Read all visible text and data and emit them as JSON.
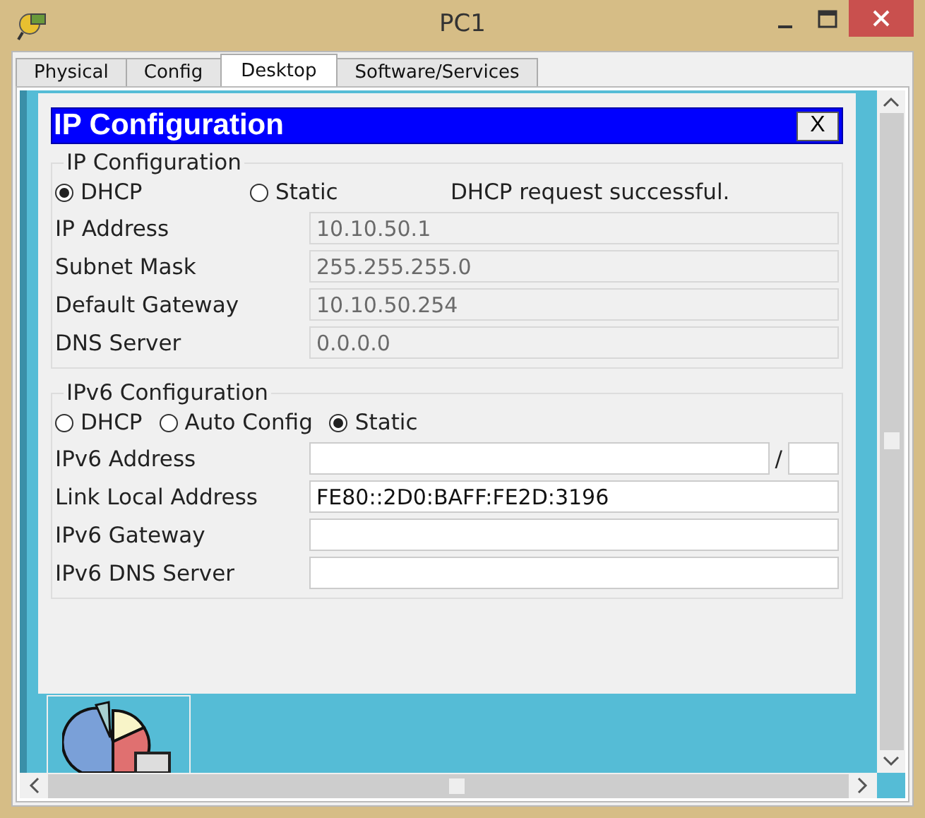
{
  "window": {
    "title": "PC1"
  },
  "tabs": [
    {
      "label": "Physical",
      "selected": false
    },
    {
      "label": "Config",
      "selected": false
    },
    {
      "label": "Desktop",
      "selected": true
    },
    {
      "label": "Software/Services",
      "selected": false
    }
  ],
  "dialog": {
    "title": "IP Configuration",
    "close": "X",
    "ipv4": {
      "legend": "IP Configuration",
      "modes": [
        {
          "label": "DHCP",
          "selected": true
        },
        {
          "label": "Static",
          "selected": false
        }
      ],
      "status": "DHCP request successful.",
      "fields": [
        {
          "label": "IP Address",
          "value": "10.10.50.1",
          "disabled": true
        },
        {
          "label": "Subnet Mask",
          "value": "255.255.255.0",
          "disabled": true
        },
        {
          "label": "Default Gateway",
          "value": "10.10.50.254",
          "disabled": true
        },
        {
          "label": "DNS Server",
          "value": "0.0.0.0",
          "disabled": true
        }
      ]
    },
    "ipv6": {
      "legend": "IPv6 Configuration",
      "modes": [
        {
          "label": "DHCP",
          "selected": false
        },
        {
          "label": "Auto Config",
          "selected": false
        },
        {
          "label": "Static",
          "selected": true
        }
      ],
      "fields": [
        {
          "label": "IPv6 Address",
          "kind": "prefix",
          "separator": "/",
          "disabled": false
        },
        {
          "label": "Link Local Address",
          "kind": "text",
          "value": "FE80::2D0:BAFF:FE2D:3196",
          "disabled": false
        },
        {
          "label": "IPv6 Gateway",
          "kind": "text",
          "disabled": false
        },
        {
          "label": "IPv6 DNS Server",
          "kind": "text",
          "disabled": false
        }
      ]
    }
  }
}
